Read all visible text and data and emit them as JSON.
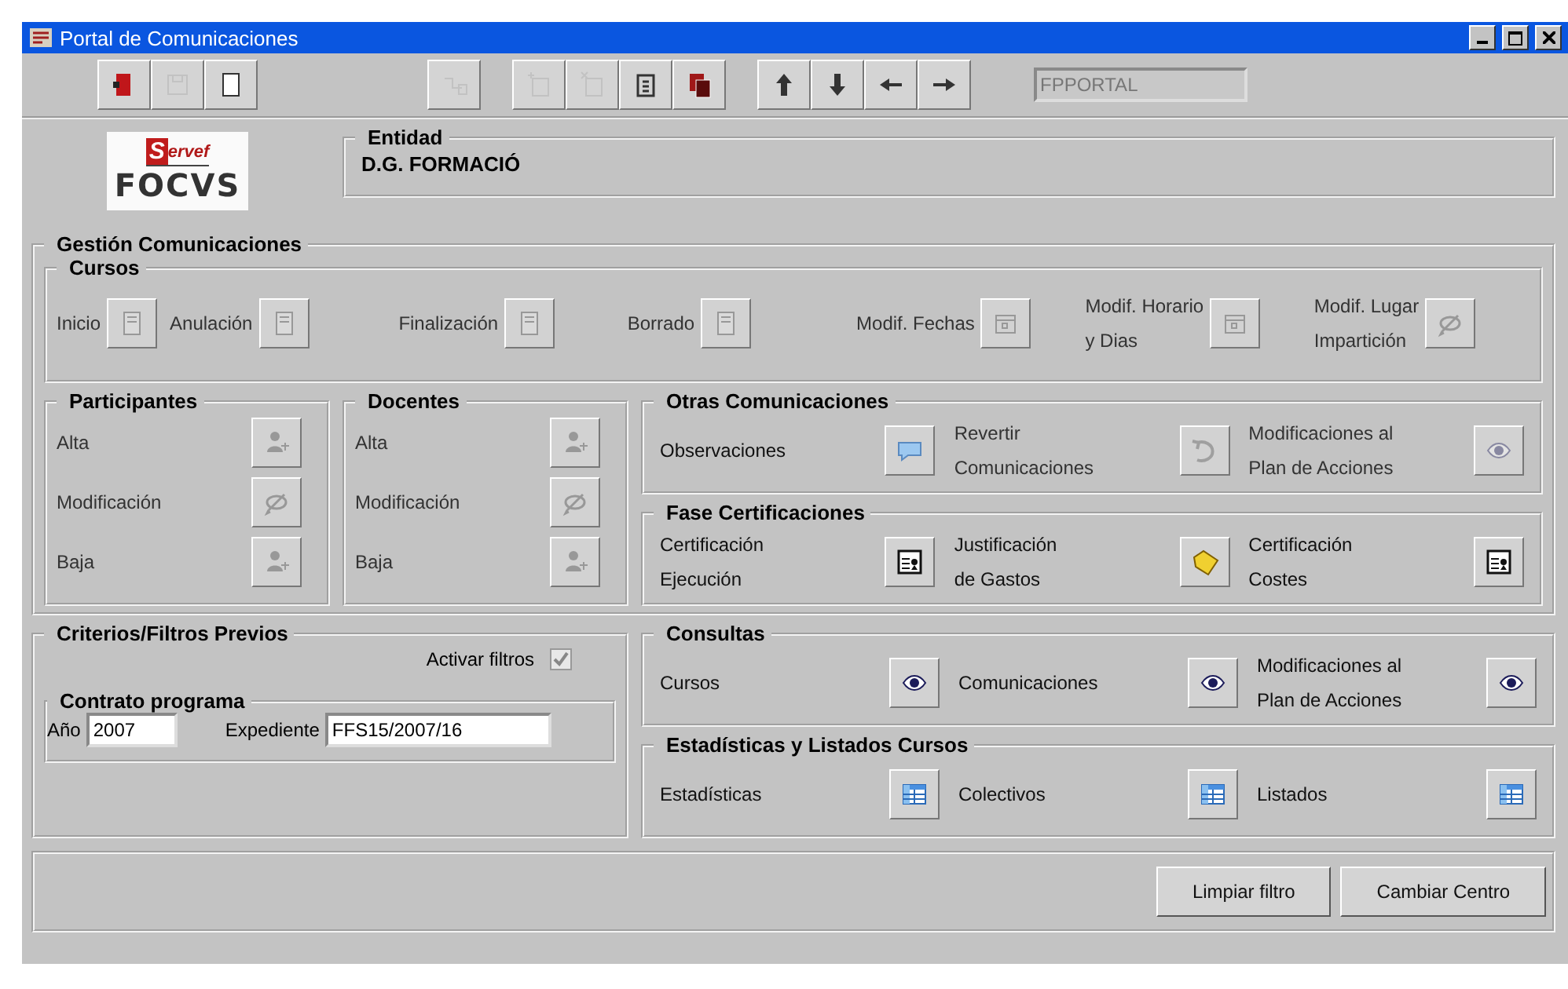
{
  "window": {
    "title": "Portal de Comunicaciones"
  },
  "toolbar": {
    "buttons": [
      {
        "disabled": false
      },
      {
        "disabled": true
      },
      {
        "disabled": false
      },
      {
        "disabled": true
      },
      {
        "disabled": true
      },
      {
        "disabled": true
      },
      {
        "disabled": false
      },
      {
        "disabled": false
      },
      {
        "disabled": false
      },
      {
        "disabled": false
      },
      {
        "disabled": false
      },
      {
        "disabled": false
      }
    ],
    "field": {
      "value": "FPPORTAL",
      "disabled": true
    }
  },
  "logo": {
    "initial": "S",
    "rest": "ervef",
    "name": "FOCVS"
  },
  "entidad": {
    "label": "Entidad",
    "value": "D.G. FORMACIÓ"
  },
  "gestion": {
    "title": "Gestión Comunicaciones",
    "cursos": {
      "title": "Cursos",
      "actions": [
        {
          "label": "Inicio",
          "disabled": true
        },
        {
          "label": "Anulación",
          "disabled": true
        },
        {
          "label": "Finalización",
          "disabled": true
        },
        {
          "label": "Borrado",
          "disabled": true
        },
        {
          "label": "Modif. Fechas",
          "disabled": true
        },
        {
          "label": "Modif. Horario\ny Dias",
          "disabled": true
        },
        {
          "label": "Modif. Lugar\nImpartición",
          "disabled": true
        }
      ]
    },
    "participantes": {
      "title": "Participantes",
      "actions": [
        {
          "label": "Alta",
          "disabled": true
        },
        {
          "label": "Modificación",
          "disabled": true
        },
        {
          "label": "Baja",
          "disabled": true
        }
      ]
    },
    "docentes": {
      "title": "Docentes",
      "actions": [
        {
          "label": "Alta",
          "disabled": true
        },
        {
          "label": "Modificación",
          "disabled": true
        },
        {
          "label": "Baja",
          "disabled": true
        }
      ]
    },
    "otras": {
      "title": "Otras Comunicaciones",
      "actions": [
        {
          "label": "Observaciones",
          "disabled": false
        },
        {
          "label": "Revertir\nComunicaciones",
          "disabled": true
        },
        {
          "label": "Modificaciones al\nPlan de Acciones",
          "disabled": true
        }
      ]
    },
    "fase": {
      "title": "Fase Certificaciones",
      "actions": [
        {
          "label": "Certificación\nEjecución",
          "disabled": false
        },
        {
          "label": "Justificación\nde Gastos",
          "disabled": false
        },
        {
          "label": "Certificación\nCostes",
          "disabled": false
        }
      ]
    }
  },
  "criterios": {
    "title": "Criterios/Filtros Previos",
    "filter": {
      "label": "Activar filtros",
      "checked": true
    },
    "contrato": {
      "title": "Contrato programa",
      "fields": [
        {
          "label": "Año",
          "value": "2007"
        },
        {
          "label": "Expediente",
          "value": "FFS15/2007/16"
        }
      ]
    }
  },
  "consultas": {
    "title": "Consultas",
    "actions": [
      {
        "label": "Cursos",
        "disabled": false
      },
      {
        "label": "Comunicaciones",
        "disabled": false
      },
      {
        "label": "Modificaciones al\nPlan de Acciones",
        "disabled": false
      }
    ]
  },
  "estadisticas": {
    "title": "Estadísticas y Listados Cursos",
    "actions": [
      {
        "label": "Estadísticas",
        "disabled": false
      },
      {
        "label": "Colectivos",
        "disabled": false
      },
      {
        "label": "Listados",
        "disabled": false
      }
    ]
  },
  "buttons": [
    "Limpiar filtro",
    "Cambiar Centro"
  ]
}
